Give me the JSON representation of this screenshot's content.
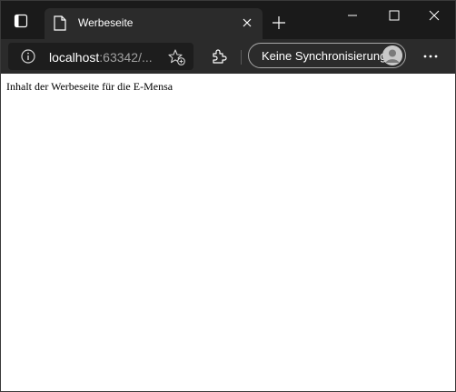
{
  "browser": {
    "tab": {
      "title": "Werbeseite",
      "favicon": "page-icon",
      "close_icon": "close-icon"
    },
    "new_tab_icon": "plus-icon",
    "tab_actions_icon": "tab-actions-icon",
    "window_controls": [
      "minimize-icon",
      "maximize-icon",
      "close-icon"
    ],
    "address_bar": {
      "info_icon": "info-icon",
      "host": "localhost",
      "rest": ":63342/...",
      "favorites_icon": "add-favorite-icon"
    },
    "extensions_icon": "puzzle-icon",
    "sync_button": {
      "label": "Keine Synchronisierung",
      "avatar_icon": "avatar-icon"
    },
    "menu_icon": "more-icon"
  },
  "page": {
    "text": "Inhalt der Werbeseite für die E-Mensa"
  },
  "colors": {
    "chrome_dark": "#1a1a1a",
    "toolbar": "#2b2b2b",
    "content_bg": "#ffffff"
  }
}
